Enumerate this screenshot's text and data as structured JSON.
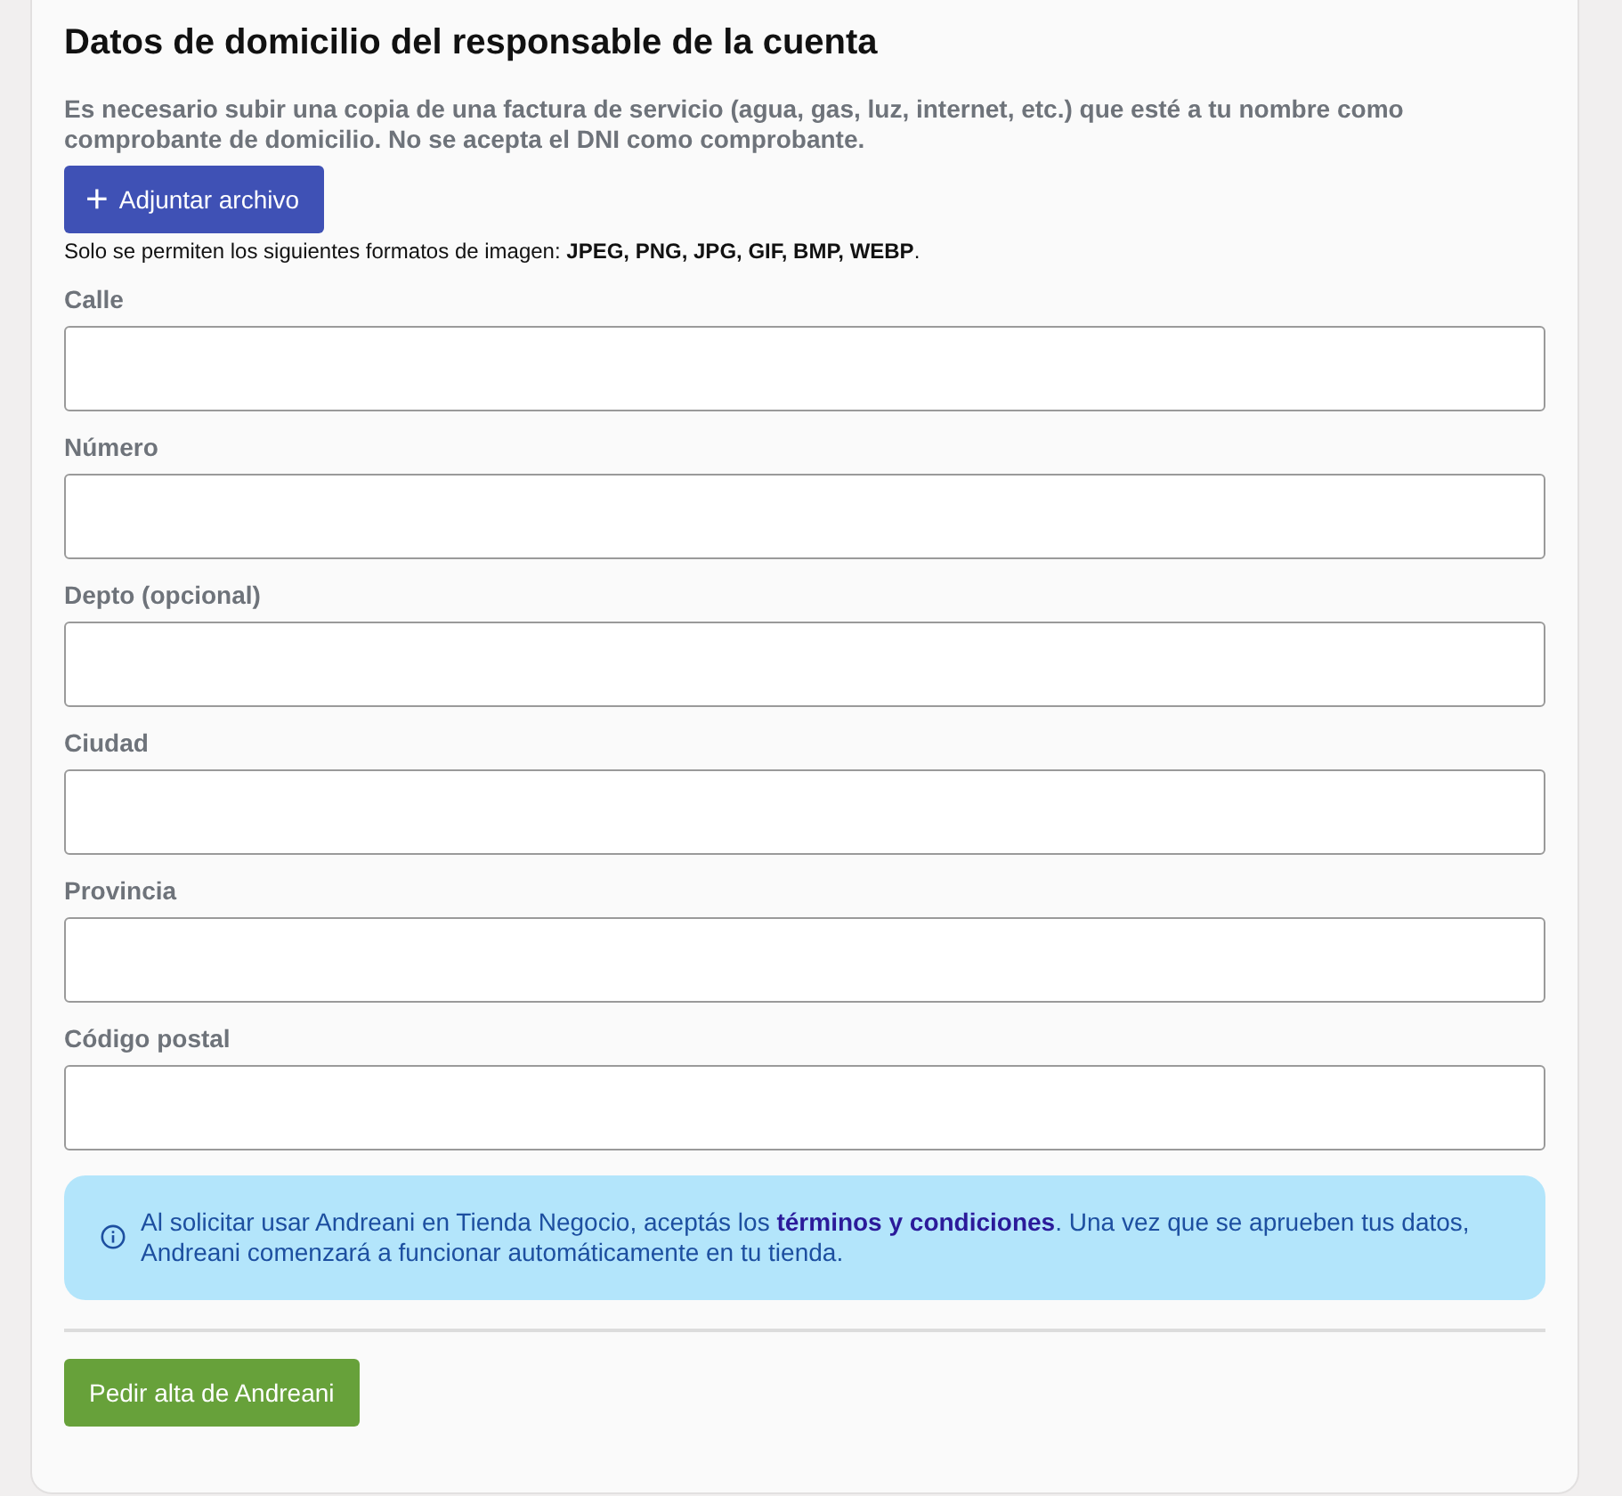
{
  "section": {
    "title": "Datos de domicilio del responsable de la cuenta",
    "description": "Es necesario subir una copia de una factura de servicio (agua, gas, luz, internet, etc.) que esté a tu nombre como comprobante de domicilio. No se acepta el DNI como comprobante.",
    "attach_button": {
      "icon": "+",
      "label": "Adjuntar archivo"
    },
    "formats_note": "Solo se permiten los siguientes formatos de imagen: **JPEG, PNG, JPG, GIF, BMP, WEBP**."
  },
  "fields": [
    {
      "label": "Calle"
    },
    {
      "label": "Número"
    },
    {
      "label": "Depto (opcional)"
    },
    {
      "label": "Ciudad"
    },
    {
      "label": "Provincia"
    },
    {
      "label": "Código postal"
    }
  ],
  "notice": {
    "text_before": "Al solicitar usar Andreani en Tienda Negocio, aceptás los ",
    "link": "términos y condiciones",
    "text_after": ". Una vez que se aprueben tus datos, Andreani comenzará a funcionar automáticamente en tu tienda."
  },
  "submit_button": {
    "label": "Pedir alta de Andreani"
  }
}
